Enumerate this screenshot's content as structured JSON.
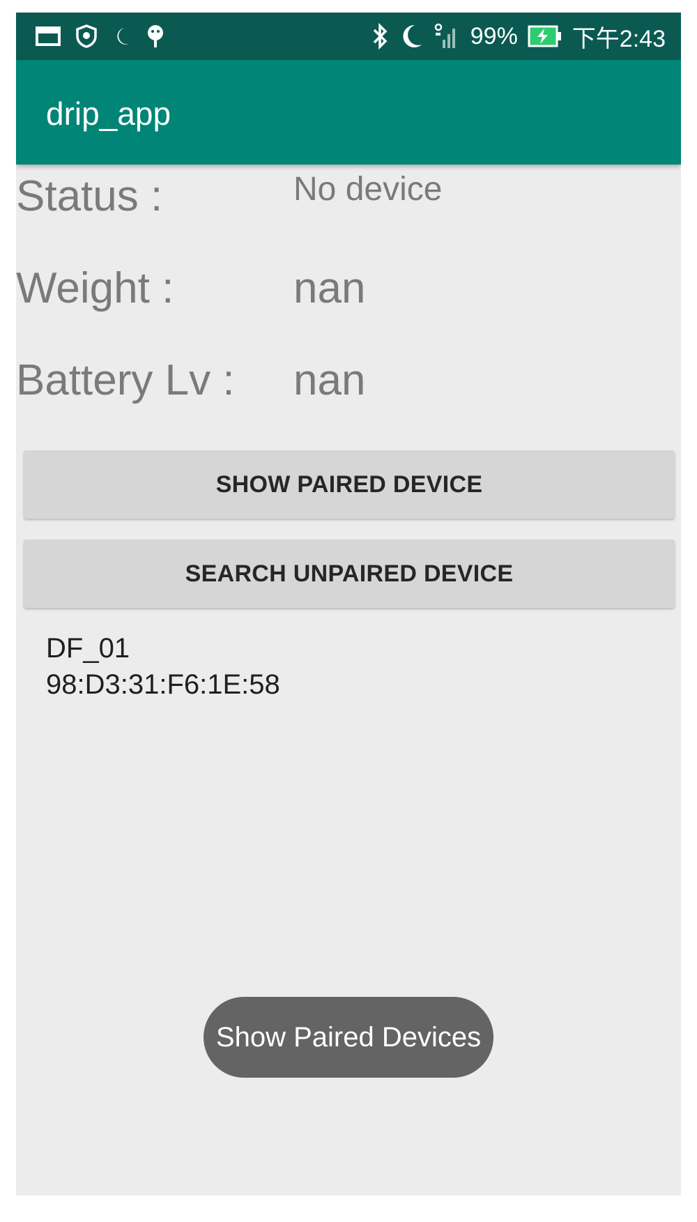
{
  "status_bar": {
    "left_icons": [
      "gallery-icon",
      "shield-icon",
      "moon-icon",
      "android-debug-icon"
    ],
    "signal_label": "ᴳ",
    "battery_percent": "99%",
    "time": "下午2:43"
  },
  "app_bar": {
    "title": "drip_app"
  },
  "fields": {
    "status": {
      "label": "Status :",
      "value": "No device"
    },
    "weight": {
      "label": "Weight :",
      "value": "nan"
    },
    "battery": {
      "label": "Battery Lv :",
      "value": "nan"
    }
  },
  "buttons": {
    "show_paired": "SHOW PAIRED DEVICE",
    "search_unpaired": "SEARCH UNPAIRED DEVICE"
  },
  "device_list": [
    {
      "name": "DF_01",
      "address": "98:D3:31:F6:1E:58"
    }
  ],
  "toast": {
    "message": "Show Paired Devices"
  },
  "colors": {
    "status_bar": "#0a5a52",
    "app_bar": "#008577",
    "background": "#ececec",
    "button": "#d6d6d6",
    "toast": "#646464",
    "battery_charging": "#2ecc71"
  }
}
